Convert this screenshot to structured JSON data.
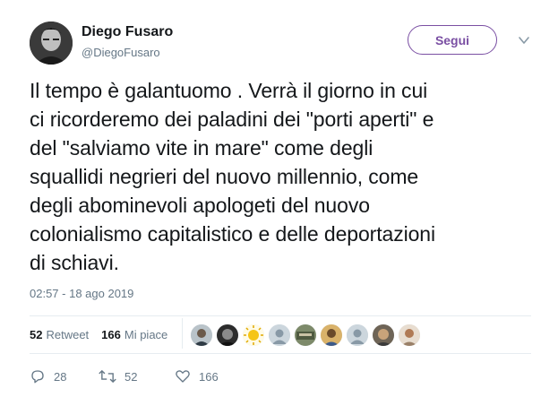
{
  "author": {
    "name": "Diego Fusaro",
    "handle": "@DiegoFusaro"
  },
  "follow_button": {
    "label": "Segui"
  },
  "tweet": {
    "text": "Il tempo è galantuomo . Verrà il giorno in cui\nci ricorderemo dei paladini dei \"porti aperti\" e\ndel \"salviamo vite in mare\" come degli\nsquallidi negrieri del nuovo millennio, come\ndegli abominevoli apologeti del nuovo\ncolonialismo capitalistico e delle deportazioni\ndi schiavi.",
    "timestamp": "02:57 - 18 ago 2019"
  },
  "stats": {
    "retweets_count": "52",
    "retweets_label": "Retweet",
    "likes_count": "166",
    "likes_label": "Mi piace"
  },
  "likers": [
    {
      "icon": "liker-avatar"
    },
    {
      "icon": "liker-avatar"
    },
    {
      "icon": "liker-avatar-sun"
    },
    {
      "icon": "liker-avatar-default"
    },
    {
      "icon": "liker-avatar"
    },
    {
      "icon": "liker-avatar"
    },
    {
      "icon": "liker-avatar-default"
    },
    {
      "icon": "liker-avatar"
    },
    {
      "icon": "liker-avatar"
    }
  ],
  "actions": {
    "reply_count": "28",
    "retweet_count": "52",
    "like_count": "166"
  },
  "colors": {
    "follow_accent": "#7a4fa3",
    "secondary_text": "#657786",
    "primary_text": "#14171a",
    "divider": "#e6ecf0"
  }
}
